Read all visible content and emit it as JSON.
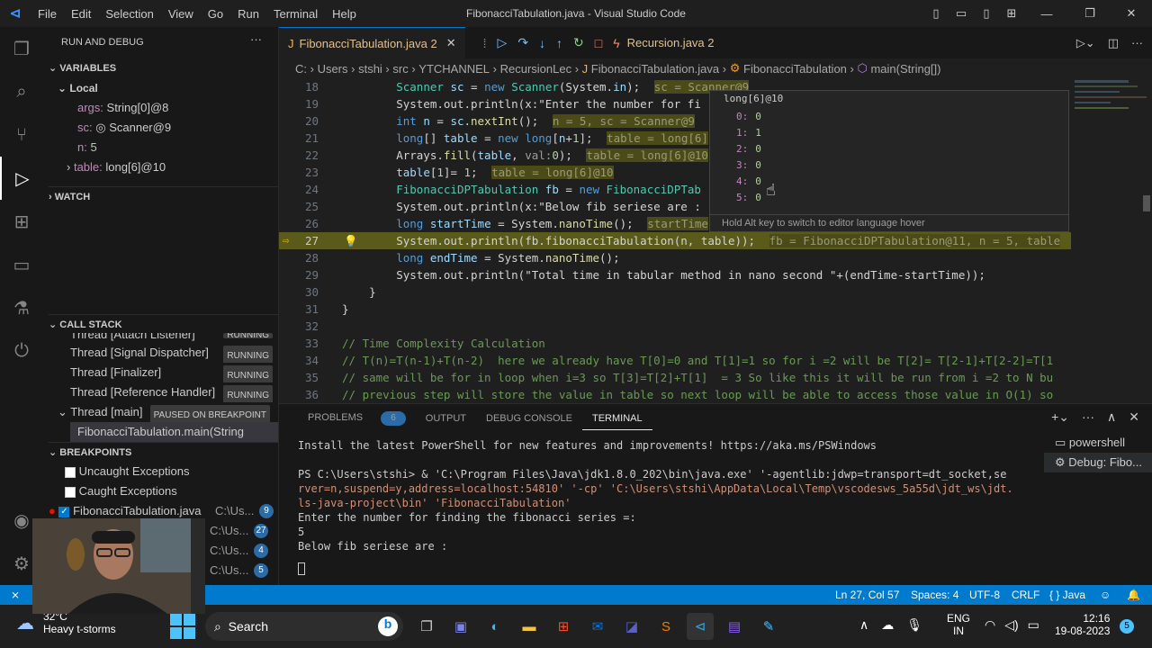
{
  "title_bar": {
    "logo": "vscode-logo",
    "menu": [
      "File",
      "Edit",
      "Selection",
      "View",
      "Go",
      "Run",
      "Terminal",
      "Help"
    ],
    "window_title": "FibonacciTabulation.java - Visual Studio Code"
  },
  "sidebar": {
    "header": "RUN AND DEBUG",
    "variables_header": "VARIABLES",
    "local_header": "Local",
    "locals": [
      {
        "name": "args:",
        "value": "String[0]@8"
      },
      {
        "name": "sc:",
        "value": "Scanner@9"
      },
      {
        "name": "n:",
        "value": "5"
      },
      {
        "name": "table:",
        "value": "long[6]@10"
      }
    ],
    "watch_header": "WATCH",
    "callstack_header": "CALL STACK",
    "threads": [
      {
        "name": "Thread [Attach Listener]",
        "state": "RUNNING"
      },
      {
        "name": "Thread [Signal Dispatcher]",
        "state": "RUNNING"
      },
      {
        "name": "Thread [Finalizer]",
        "state": "RUNNING"
      },
      {
        "name": "Thread [Reference Handler]",
        "state": "RUNNING"
      },
      {
        "name": "Thread [main]",
        "state": "PAUSED ON BREAKPOINT"
      }
    ],
    "frame": "FibonacciTabulation.main(String",
    "breakpoints_header": "BREAKPOINTS",
    "breakpoints": [
      {
        "label": "Uncaught Exceptions"
      },
      {
        "label": "Caught Exceptions"
      },
      {
        "label": "FibonacciTabulation.java",
        "path": "C:\\Us...",
        "count": "9"
      },
      {
        "label": "",
        "path": "C:\\Us...",
        "count": "27"
      },
      {
        "label": "",
        "path": "C:\\Us...",
        "count": "4"
      },
      {
        "label": "",
        "path": "C:\\Us...",
        "count": "5"
      }
    ]
  },
  "tabs": [
    {
      "label": "FibonacciTabulation.java",
      "count": "2"
    },
    {
      "label": "Recursion.java",
      "count": "2"
    }
  ],
  "breadcrumb": [
    "C:",
    "Users",
    "stshi",
    "src",
    "YTCHANNEL",
    "RecursionLec",
    "FibonacciTabulation.java",
    "FibonacciTabulation",
    "main(String[])"
  ],
  "editor": {
    "lines": [
      {
        "n": "18",
        "text": "        Scanner sc = new Scanner(System.in);",
        "inline": "sc = Scanner@9"
      },
      {
        "n": "19",
        "text": "        System.out.println(x:\"Enter the number for fi",
        "inline": ""
      },
      {
        "n": "20",
        "text": "        int n = sc.nextInt();",
        "inline": "n = 5, sc = Scanner@9"
      },
      {
        "n": "21",
        "text": "        long[] table = new long[n+1];",
        "inline": "table = long[6]"
      },
      {
        "n": "22",
        "text": "        Arrays.fill(table, val:0);",
        "inline": "table = long[6]@10"
      },
      {
        "n": "23",
        "text": "        table[1]= 1;",
        "inline": "table = long[6]@10"
      },
      {
        "n": "24",
        "text": "        FibonacciDPTabulation fb = new FibonacciDPTab",
        "inline": ""
      },
      {
        "n": "25",
        "text": "        System.out.println(x:\"Below fib seriese are :",
        "inline": ""
      },
      {
        "n": "26",
        "text": "        long startTime = System.nanoTime();",
        "inline": "startTime"
      },
      {
        "n": "27",
        "text": "        System.out.println(fb.fibonacciTabulation(n, table));",
        "inline": "fb = FibonacciDPTabulation@11, n = 5, table"
      },
      {
        "n": "28",
        "text": "        long endTime = System.nanoTime();",
        "inline": ""
      },
      {
        "n": "29",
        "text": "        System.out.println(\"Total time in tabular method in nano second \"+(endTime-startTime));",
        "inline": ""
      },
      {
        "n": "30",
        "text": "    }",
        "inline": ""
      },
      {
        "n": "31",
        "text": "}",
        "inline": ""
      },
      {
        "n": "32",
        "text": "",
        "inline": ""
      },
      {
        "n": "33",
        "text": "// Time Complexity Calculation",
        "inline": ""
      },
      {
        "n": "34",
        "text": "// T(n)=T(n-1)+T(n-2)  here we already have T[0]=0 and T[1]=1 so for i =2 will be T[2]= T[2-1]+T[2-2]=T[1",
        "inline": ""
      },
      {
        "n": "35",
        "text": "// same will be for in loop when i=3 so T[3]=T[2]+T[1]  = 3 So like this it will be run from i =2 to N bu",
        "inline": ""
      },
      {
        "n": "36",
        "text": "// previous step will store the value in table so next loop will be able to access those value in O(1) so",
        "inline": ""
      }
    ],
    "current_line": "27"
  },
  "hover": {
    "title": "long[6]@10",
    "items": [
      {
        "idx": "0:",
        "val": "0"
      },
      {
        "idx": "1:",
        "val": "1"
      },
      {
        "idx": "2:",
        "val": "0"
      },
      {
        "idx": "3:",
        "val": "0"
      },
      {
        "idx": "4:",
        "val": "0"
      },
      {
        "idx": "5:",
        "val": "0"
      }
    ],
    "hint": "Hold Alt key to switch to editor language hover"
  },
  "panel": {
    "tabs": [
      "PROBLEMS",
      "OUTPUT",
      "DEBUG CONSOLE",
      "TERMINAL"
    ],
    "problems_count": "6",
    "terminal_lines": [
      "Install the latest PowerShell for new features and improvements! https://aka.ms/PSWindows",
      "",
      "PS C:\\Users\\stshi>  & 'C:\\Program Files\\Java\\jdk1.8.0_202\\bin\\java.exe' '-agentlib:jdwp=transport=dt_socket,se",
      "rver=n,suspend=y,address=localhost:54810' '-cp' 'C:\\Users\\stshi\\AppData\\Local\\Temp\\vscodesws_5a55d\\jdt_ws\\jdt.",
      "ls-java-project\\bin' 'FibonacciTabulation'",
      "Enter the number for finding the fibonacci series =:",
      "5",
      "Below fib seriese are :"
    ],
    "terminals": [
      "powershell",
      "Debug: Fibo..."
    ]
  },
  "status_bar": {
    "position": "Ln 27, Col 57",
    "spaces": "Spaces: 4",
    "encoding": "UTF-8",
    "eol": "CRLF",
    "language": "{ } Java"
  },
  "taskbar": {
    "weather_temp": "32°C",
    "weather_desc": "Heavy t-storms",
    "search": "Search",
    "lang": "ENG",
    "lang2": "IN",
    "time": "12:16",
    "date": "19-08-2023",
    "notif": "5"
  }
}
